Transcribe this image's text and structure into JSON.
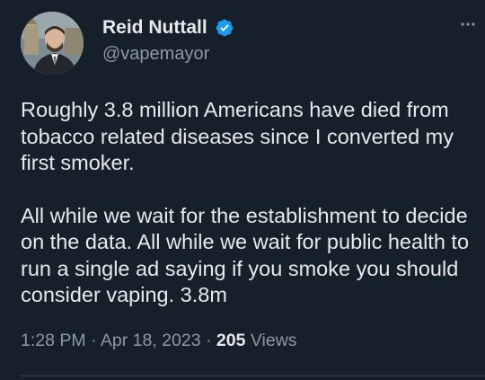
{
  "author": {
    "display_name": "Reid Nuttall",
    "handle": "@vapemayor",
    "verified": true,
    "verified_color": "#1d9bf0"
  },
  "menu": {
    "icon": "more-horizontal-icon"
  },
  "tweet": {
    "paragraphs": [
      "Roughly 3.8 million Americans have died from tobacco related diseases since I converted my first smoker.",
      "All while we wait for the establishment to decide on the data.  All while we wait for public health to run a single ad saying if you smoke you should consider vaping. 3.8m"
    ]
  },
  "meta": {
    "time": "1:28 PM",
    "separator": "·",
    "date": "Apr 18, 2023",
    "views_count": "205",
    "views_label": "Views"
  },
  "theme": {
    "background": "#15202b",
    "text": "#e7e9ea",
    "secondary_text": "#8b98a5",
    "divider": "#38444d"
  }
}
